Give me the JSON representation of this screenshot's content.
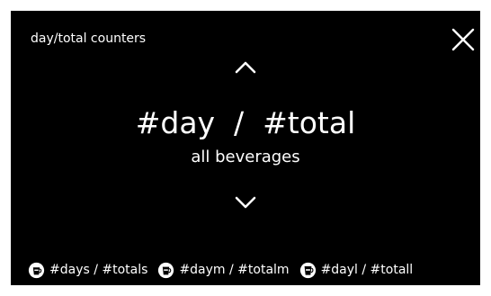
{
  "header": {
    "title": "day/total counters",
    "close_icon": "close-icon"
  },
  "navigation": {
    "up_icon": "chevron-up-icon",
    "down_icon": "chevron-down-icon"
  },
  "counter": {
    "main": "#day  /  #total",
    "sub": "all beverages"
  },
  "size_counters": [
    {
      "icon": "cup-icon",
      "label": "#days / #totals"
    },
    {
      "icon": "cup-icon",
      "label": "#daym / #totalm"
    },
    {
      "icon": "cup-icon",
      "label": "#dayl / #totall"
    }
  ],
  "colors": {
    "background": "#000000",
    "foreground": "#ffffff"
  }
}
